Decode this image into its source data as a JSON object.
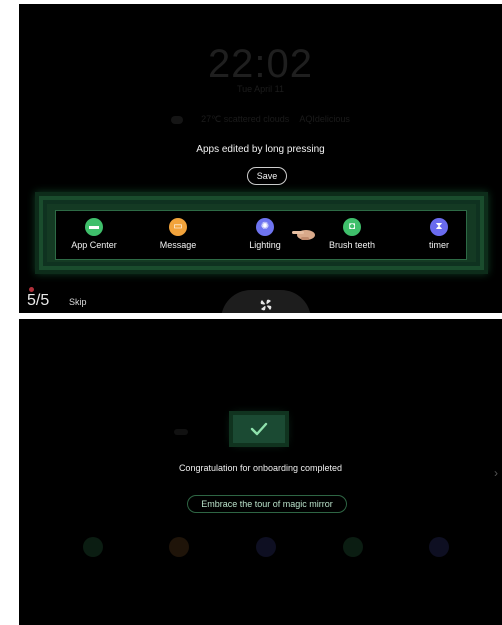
{
  "top": {
    "clock": "22:02",
    "date": "Tue April 11",
    "weather": {
      "temp": "27℃ scattered clouds",
      "aqi": "AQIdelicious"
    },
    "hint": "Apps edited by long pressing",
    "save_label": "Save",
    "apps": [
      {
        "label": "App Center",
        "color": "#3fbf6b",
        "icon": "app-center-icon",
        "glyph": "▬"
      },
      {
        "label": "Message",
        "color": "#f2a33b",
        "icon": "message-icon",
        "glyph": "▭"
      },
      {
        "label": "Lighting",
        "color": "#6e74f0",
        "icon": "lighting-icon",
        "glyph": "✺"
      },
      {
        "label": "Brush teeth",
        "color": "#3fbf6b",
        "icon": "brush-teeth-icon",
        "glyph": "◘"
      },
      {
        "label": "timer",
        "color": "#6a6bef",
        "icon": "timer-icon",
        "glyph": "⧗"
      }
    ],
    "step": "5/5",
    "skip_label": "Skip"
  },
  "bottom": {
    "congrats": "Congratulation for onboarding completed",
    "tour_label": "Embrace the tour of magic mirror",
    "accent": "#1b4a33"
  }
}
